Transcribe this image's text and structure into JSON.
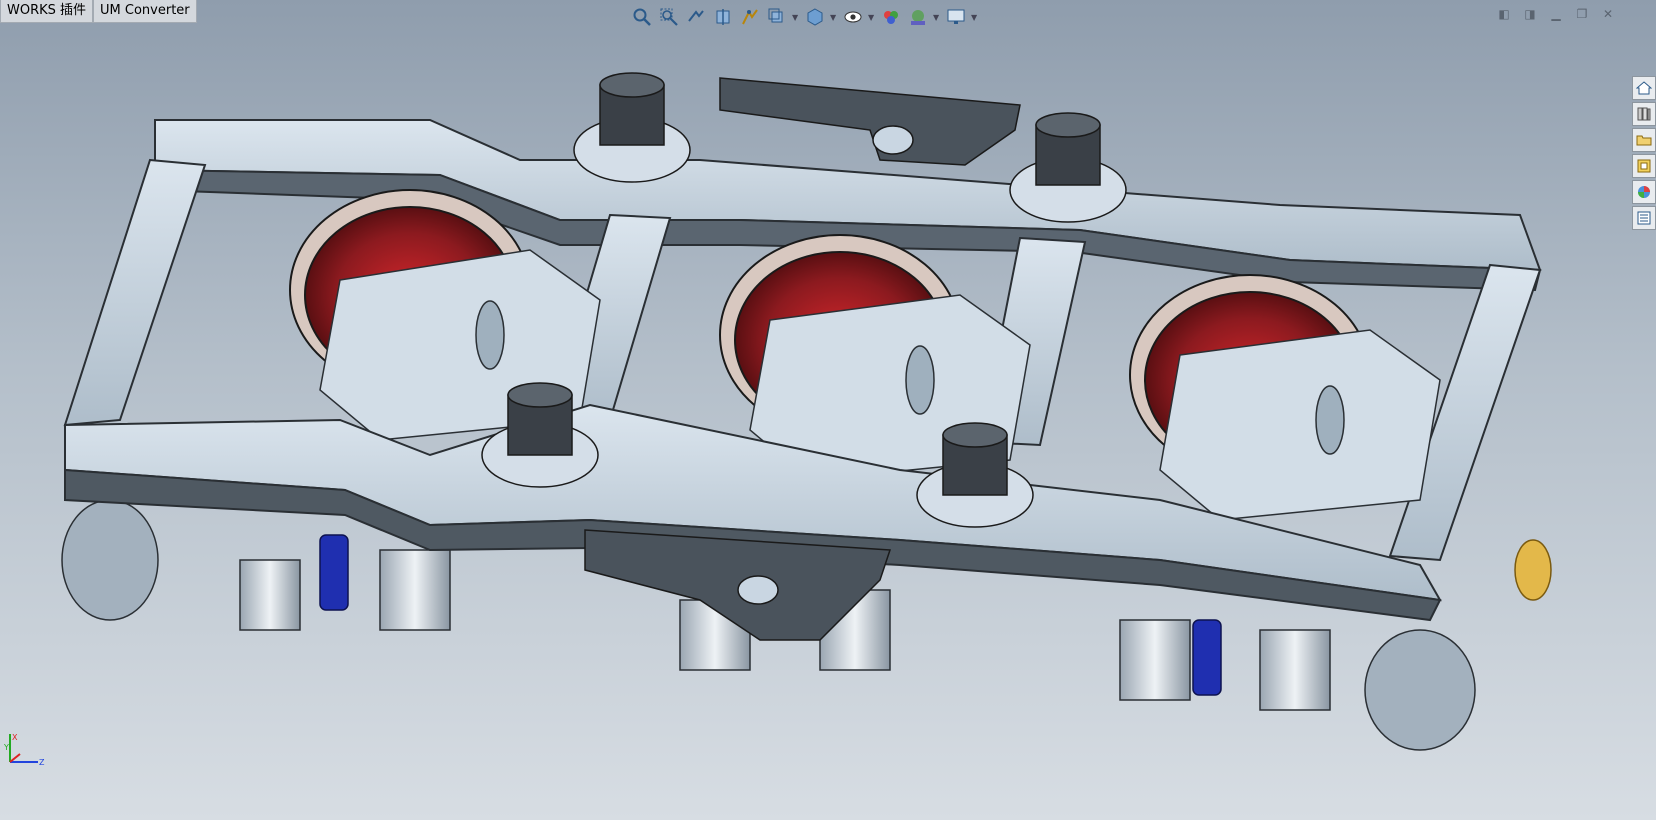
{
  "tabs": [
    {
      "label": "WORKS 插件"
    },
    {
      "label": "UM Converter"
    }
  ],
  "heads_up_toolbar": [
    {
      "icon": "zoom-to-fit-icon"
    },
    {
      "icon": "zoom-to-area-icon"
    },
    {
      "icon": "previous-view-icon"
    },
    {
      "icon": "section-view-icon"
    },
    {
      "icon": "dynamic-annotation-views-icon"
    },
    {
      "icon": "view-orientation-icon"
    },
    {
      "icon": "display-style-icon"
    },
    {
      "icon": "hide-show-items-icon"
    },
    {
      "icon": "edit-appearance-icon"
    },
    {
      "icon": "apply-scene-icon"
    },
    {
      "icon": "view-settings-icon"
    }
  ],
  "task_pane": [
    {
      "icon": "home-icon"
    },
    {
      "icon": "design-library-icon"
    },
    {
      "icon": "file-explorer-icon"
    },
    {
      "icon": "view-palette-icon"
    },
    {
      "icon": "appearances-icon"
    },
    {
      "icon": "custom-properties-icon"
    }
  ],
  "triad": {
    "axes": [
      "X",
      "Y",
      "Z"
    ]
  },
  "colors": {
    "frame": "#c9d6e2",
    "frame_shade": "#505a63",
    "wheel": "#8c1a1f",
    "damper": "#1f2fb0",
    "bolster_accent": "#e3b84a"
  }
}
